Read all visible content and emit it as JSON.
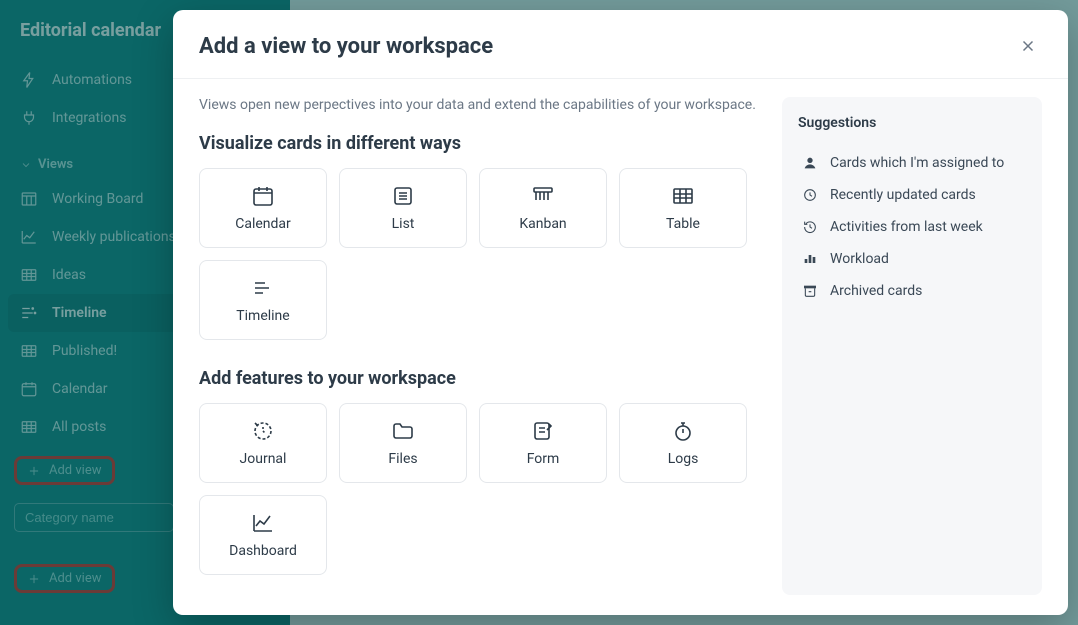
{
  "sidebar": {
    "workspace_title": "Editorial calendar",
    "nav": {
      "automations": "Automations",
      "integrations": "Integrations"
    },
    "views_header": "Views",
    "views": [
      {
        "label": "Working Board",
        "icon": "board"
      },
      {
        "label": "Weekly publications",
        "icon": "line"
      },
      {
        "label": "Ideas",
        "icon": "table"
      },
      {
        "label": "Timeline",
        "icon": "timeline",
        "active": true
      },
      {
        "label": "Published!",
        "icon": "table"
      },
      {
        "label": "Calendar",
        "icon": "calendar"
      },
      {
        "label": "All posts",
        "icon": "table"
      }
    ],
    "add_view_label": "Add view",
    "category_placeholder": "Category name"
  },
  "modal": {
    "title": "Add a view to your workspace",
    "description": "Views open new perpectives into your data and extend the capabilities of your workspace.",
    "section_visualize": "Visualize cards in different ways",
    "visualize_tiles": [
      {
        "label": "Calendar",
        "icon": "calendar"
      },
      {
        "label": "List",
        "icon": "list"
      },
      {
        "label": "Kanban",
        "icon": "kanban"
      },
      {
        "label": "Table",
        "icon": "table"
      },
      {
        "label": "Timeline",
        "icon": "timeline"
      }
    ],
    "section_features": "Add features to your workspace",
    "feature_tiles": [
      {
        "label": "Journal",
        "icon": "journal"
      },
      {
        "label": "Files",
        "icon": "files"
      },
      {
        "label": "Form",
        "icon": "form"
      },
      {
        "label": "Logs",
        "icon": "logs"
      },
      {
        "label": "Dashboard",
        "icon": "dashboard"
      }
    ],
    "suggestions": {
      "title": "Suggestions",
      "items": [
        {
          "label": "Cards which I'm assigned to",
          "icon": "user"
        },
        {
          "label": "Recently updated cards",
          "icon": "clock"
        },
        {
          "label": "Activities from last week",
          "icon": "history"
        },
        {
          "label": "Workload",
          "icon": "workload"
        },
        {
          "label": "Archived cards",
          "icon": "archive"
        }
      ]
    }
  }
}
